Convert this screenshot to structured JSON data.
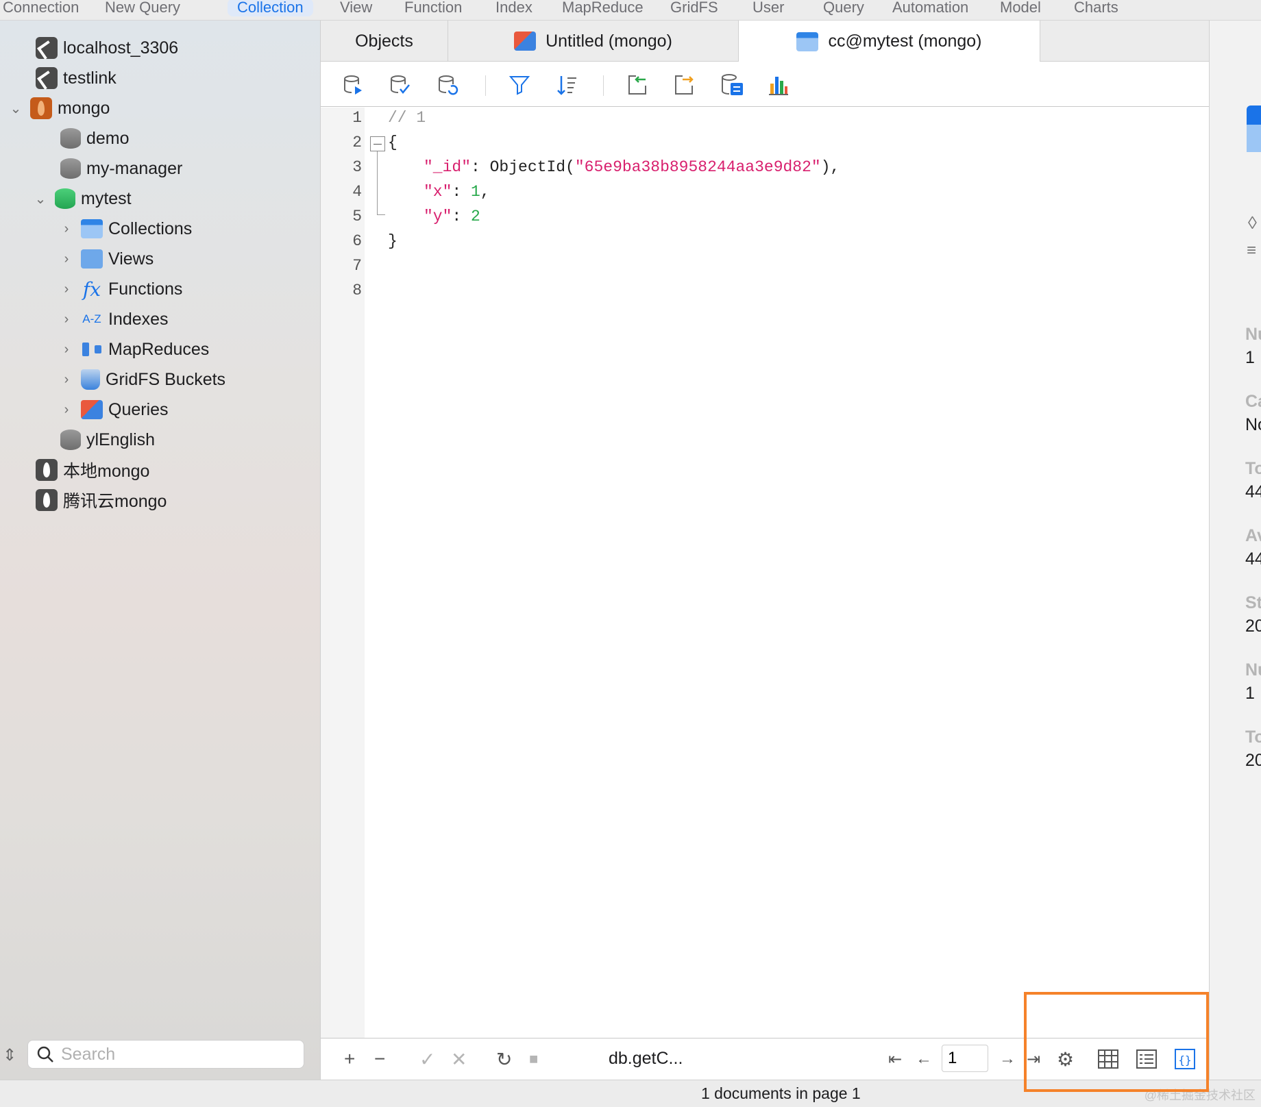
{
  "menu": {
    "items": [
      "Connection",
      "New Query",
      "Collection",
      "View",
      "Function",
      "Index",
      "MapReduce",
      "GridFS",
      "User",
      "Query",
      "Automation",
      "Model",
      "Charts"
    ],
    "active": "Collection"
  },
  "sidebar": {
    "connections": [
      {
        "label": "localhost_3306",
        "icon": "mysql-connection-icon"
      },
      {
        "label": "testlink",
        "icon": "mysql-connection-icon"
      },
      {
        "label": "mongo",
        "icon": "mongo-connection-icon",
        "expanded": true
      }
    ],
    "databases": [
      {
        "label": "demo"
      },
      {
        "label": "my-manager"
      },
      {
        "label": "mytest",
        "expanded": true
      }
    ],
    "mytest_children": [
      {
        "label": "Collections",
        "icon": "collections-icon"
      },
      {
        "label": "Views",
        "icon": "views-icon"
      },
      {
        "label": "Functions",
        "icon": "functions-icon"
      },
      {
        "label": "Indexes",
        "icon": "indexes-icon",
        "icon_text": "A-Z"
      },
      {
        "label": "MapReduces",
        "icon": "mapreduce-icon"
      },
      {
        "label": "GridFS Buckets",
        "icon": "gridfs-icon"
      },
      {
        "label": "Queries",
        "icon": "queries-icon"
      }
    ],
    "other_db": {
      "label": "ylEnglish"
    },
    "other_connections": [
      {
        "label": "本地mongo"
      },
      {
        "label": "腾讯云mongo"
      }
    ],
    "search": {
      "placeholder": "Search"
    }
  },
  "tabs": [
    {
      "label": "Objects"
    },
    {
      "label": "Untitled (mongo)"
    },
    {
      "label": "cc@mytest (mongo)",
      "active": true
    }
  ],
  "toolbar": {
    "icons": [
      "run-icon",
      "validate-icon",
      "refresh-db-icon",
      "filter-icon",
      "sort-icon",
      "import-icon",
      "export-icon",
      "data-generator-icon",
      "chart-icon"
    ]
  },
  "editor": {
    "line_numbers": [
      "1",
      "2",
      "3",
      "4",
      "5",
      "6",
      "7",
      "8"
    ],
    "comment": "// 1",
    "open_brace": "{",
    "close_brace": "}",
    "id_key": "\"_id\"",
    "id_func": "ObjectId(",
    "id_value": "\"65e9ba38b8958244aa3e9d82\"",
    "id_close": "),",
    "x_key": "\"x\"",
    "x_value": "1",
    "y_key": "\"y\"",
    "y_value": "2",
    "colon": ": ",
    "comma": ","
  },
  "bottombar": {
    "query_text": "db.getC...",
    "page_value": "1",
    "icons": [
      "add-icon",
      "remove-icon",
      "apply-icon",
      "discard-icon",
      "reload-icon",
      "stop-icon",
      "first-page-icon",
      "prev-page-icon",
      "next-page-icon",
      "last-page-icon",
      "settings-icon",
      "grid-view-icon",
      "tree-view-icon",
      "json-view-icon"
    ]
  },
  "status": {
    "text": "1 documents in page 1",
    "watermark": "@稀土掘金技术社区"
  },
  "info_panel": {
    "entries": [
      {
        "label": "Nu",
        "value": "1"
      },
      {
        "label": "Ca",
        "value": "No"
      },
      {
        "label": "To",
        "value": "44"
      },
      {
        "label": "Av",
        "value": "44"
      },
      {
        "label": "St",
        "value": "20"
      },
      {
        "label": "Nu",
        "value": "1"
      },
      {
        "label": "To",
        "value": "20"
      }
    ]
  },
  "colors": {
    "accent": "#1a73e8",
    "highlight": "#f5822a",
    "string": "#d8206e",
    "number": "#26a84a"
  }
}
